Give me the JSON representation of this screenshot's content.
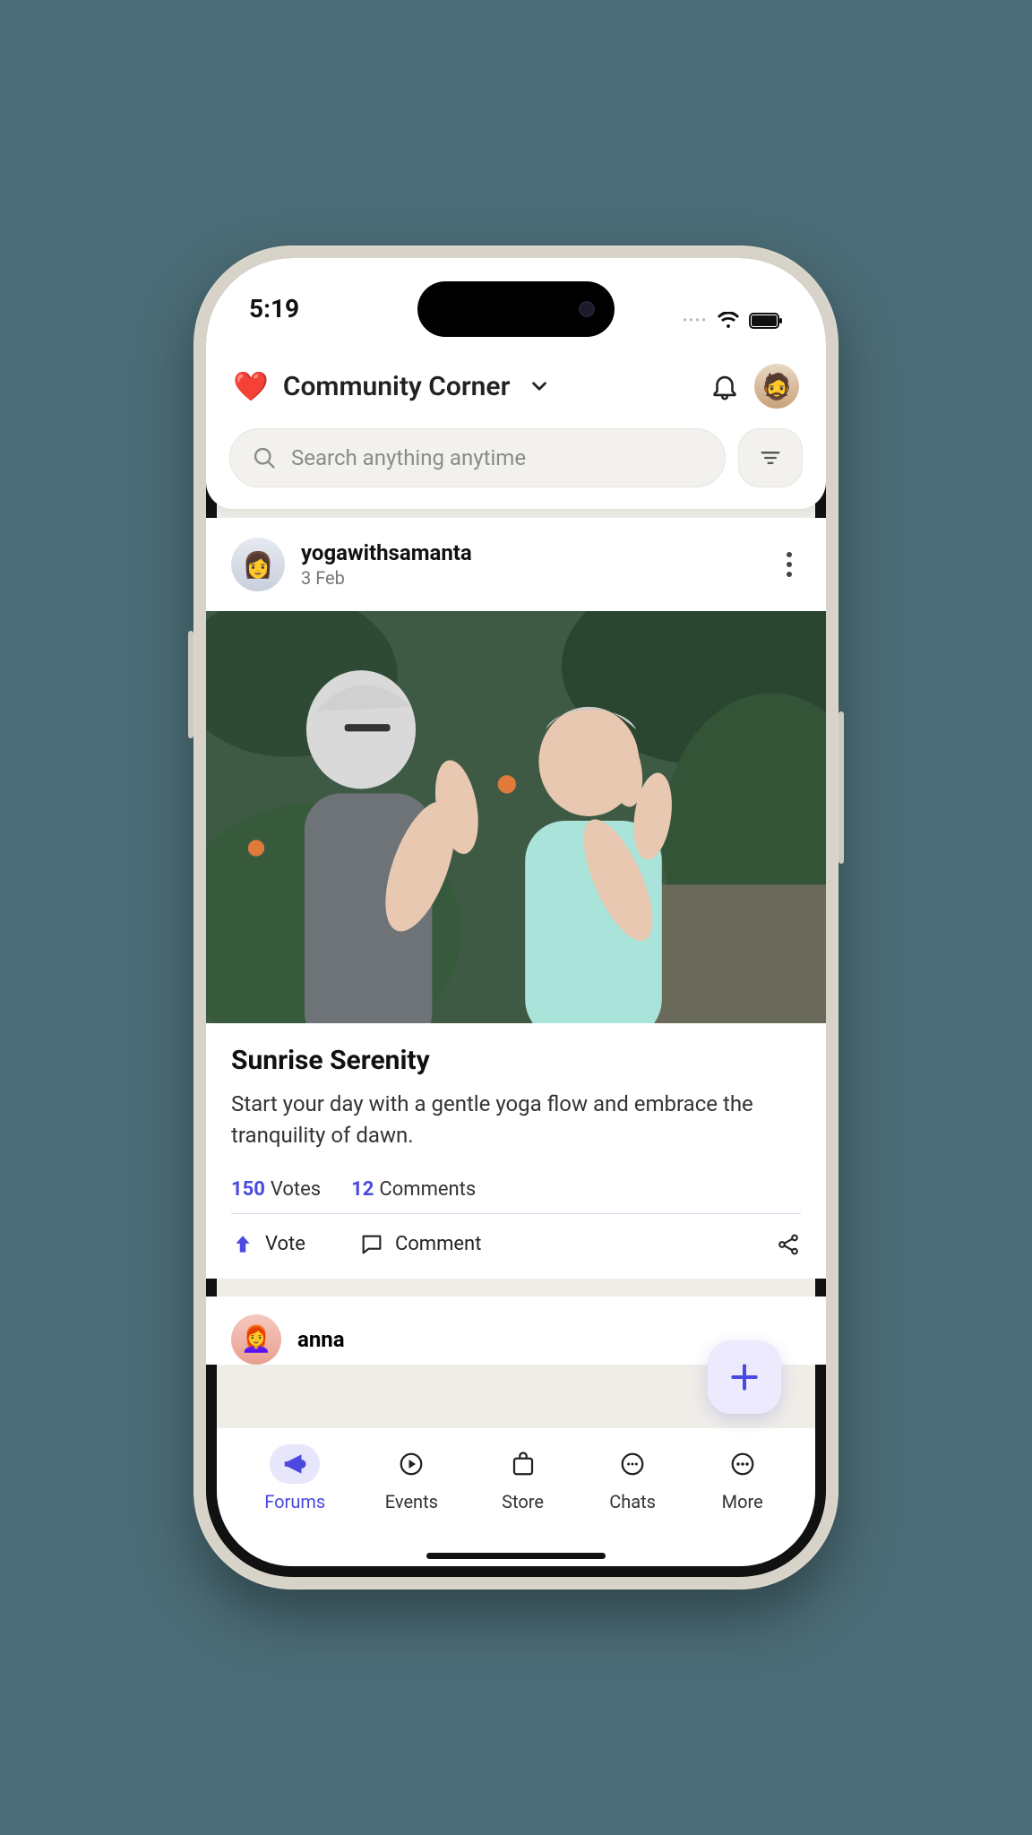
{
  "status": {
    "time": "5:19"
  },
  "header": {
    "emoji": "❤️",
    "title": "Community Corner"
  },
  "search": {
    "placeholder": "Search anything anytime"
  },
  "post": {
    "author": "yogawithsamanta",
    "date": "3 Feb",
    "title": "Sunrise Serenity",
    "description": "Start your day with a gentle yoga flow and embrace the tranquility of dawn.",
    "votes_count": "150",
    "votes_label": "Votes",
    "comments_count": "12",
    "comments_label": "Comments",
    "vote_action": "Vote",
    "comment_action": "Comment"
  },
  "next_post": {
    "author": "anna"
  },
  "tabs": {
    "forums": "Forums",
    "events": "Events",
    "store": "Store",
    "chats": "Chats",
    "more": "More"
  },
  "colors": {
    "accent": "#4a49e0"
  }
}
